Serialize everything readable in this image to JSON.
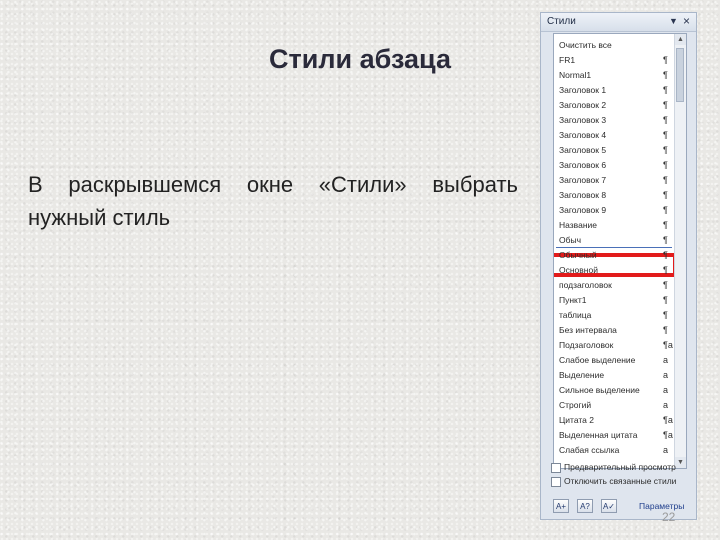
{
  "slide": {
    "title": "Стили абзаца",
    "body": "В раскрывшемся окне «Стили» выбрать нужный стиль",
    "page_number": "22"
  },
  "pane": {
    "title": "Стили",
    "items": [
      {
        "label": "Очистить все",
        "mark": ""
      },
      {
        "label": "FR1",
        "mark": "¶"
      },
      {
        "label": "Normal1",
        "mark": "¶"
      },
      {
        "label": "Заголовок 1",
        "mark": "¶"
      },
      {
        "label": "Заголовок 2",
        "mark": "¶"
      },
      {
        "label": "Заголовок 3",
        "mark": "¶"
      },
      {
        "label": "Заголовок 4",
        "mark": "¶"
      },
      {
        "label": "Заголовок 5",
        "mark": "¶"
      },
      {
        "label": "Заголовок 6",
        "mark": "¶"
      },
      {
        "label": "Заголовок 7",
        "mark": "¶"
      },
      {
        "label": "Заголовок 8",
        "mark": "¶"
      },
      {
        "label": "Заголовок 9",
        "mark": "¶"
      },
      {
        "label": "Название",
        "mark": "¶"
      },
      {
        "label": "Обыч",
        "mark": "¶"
      },
      {
        "label": "Обычный",
        "mark": "¶"
      },
      {
        "label": "Основной",
        "mark": "¶"
      },
      {
        "label": "подзаголовок",
        "mark": "¶"
      },
      {
        "label": "Пункт1",
        "mark": "¶"
      },
      {
        "label": "таблица",
        "mark": "¶"
      },
      {
        "label": "Без интервала",
        "mark": "¶"
      },
      {
        "label": "Подзаголовок",
        "mark": "¶a"
      },
      {
        "label": "Слабое выделение",
        "mark": "a"
      },
      {
        "label": "Выделение",
        "mark": "a"
      },
      {
        "label": "Сильное выделение",
        "mark": "a"
      },
      {
        "label": "Строгий",
        "mark": "a"
      },
      {
        "label": "Цитата 2",
        "mark": "¶a"
      },
      {
        "label": "Выделенная цитата",
        "mark": "¶a"
      },
      {
        "label": "Слабая ссылка",
        "mark": "a"
      }
    ],
    "show_preview_label": "Предварительный просмотр",
    "disable_linked_label": "Отключить связанные стили",
    "new_style_icon": "new-style-icon",
    "style_inspector_icon": "style-inspector-icon",
    "manage_styles_icon": "manage-styles-icon",
    "params_label": "Параметры"
  }
}
